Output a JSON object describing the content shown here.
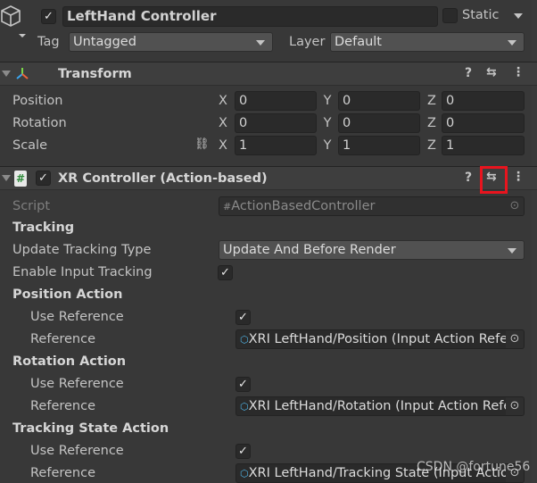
{
  "header": {
    "name": "LeftHand Controller",
    "active": true,
    "static_label": "Static",
    "static": false,
    "tag_label": "Tag",
    "tag_value": "Untagged",
    "layer_label": "Layer",
    "layer_value": "Default"
  },
  "transform": {
    "title": "Transform",
    "rows": [
      {
        "label": "Position",
        "x": "0",
        "y": "0",
        "z": "0"
      },
      {
        "label": "Rotation",
        "x": "0",
        "y": "0",
        "z": "0"
      },
      {
        "label": "Scale",
        "x": "1",
        "y": "1",
        "z": "1"
      }
    ]
  },
  "axes": {
    "x": "X",
    "y": "Y",
    "z": "Z"
  },
  "xr": {
    "title": "XR Controller (Action-based)",
    "enabled": true,
    "script_label": "Script",
    "script_value": "ActionBasedController",
    "tracking_label": "Tracking",
    "update_tracking_label": "Update Tracking Type",
    "update_tracking_value": "Update And Before Render",
    "enable_input_label": "Enable Input Tracking",
    "enable_input": true,
    "sections": [
      {
        "title": "Position Action",
        "use_ref_label": "Use Reference",
        "use_ref": true,
        "ref_label": "Reference",
        "ref_value": "XRI LeftHand/Position (Input Action Reference)"
      },
      {
        "title": "Rotation Action",
        "use_ref_label": "Use Reference",
        "use_ref": true,
        "ref_label": "Reference",
        "ref_value": "XRI LeftHand/Rotation (Input Action Reference)"
      },
      {
        "title": "Tracking State Action",
        "use_ref_label": "Use Reference",
        "use_ref": true,
        "ref_label": "Reference",
        "ref_value": "XRI LeftHand/Tracking State (Input Action Reference)"
      }
    ]
  },
  "watermark": "CSDN @fortune56",
  "colors": {
    "highlight": "#e8141e",
    "background": "#383838"
  }
}
